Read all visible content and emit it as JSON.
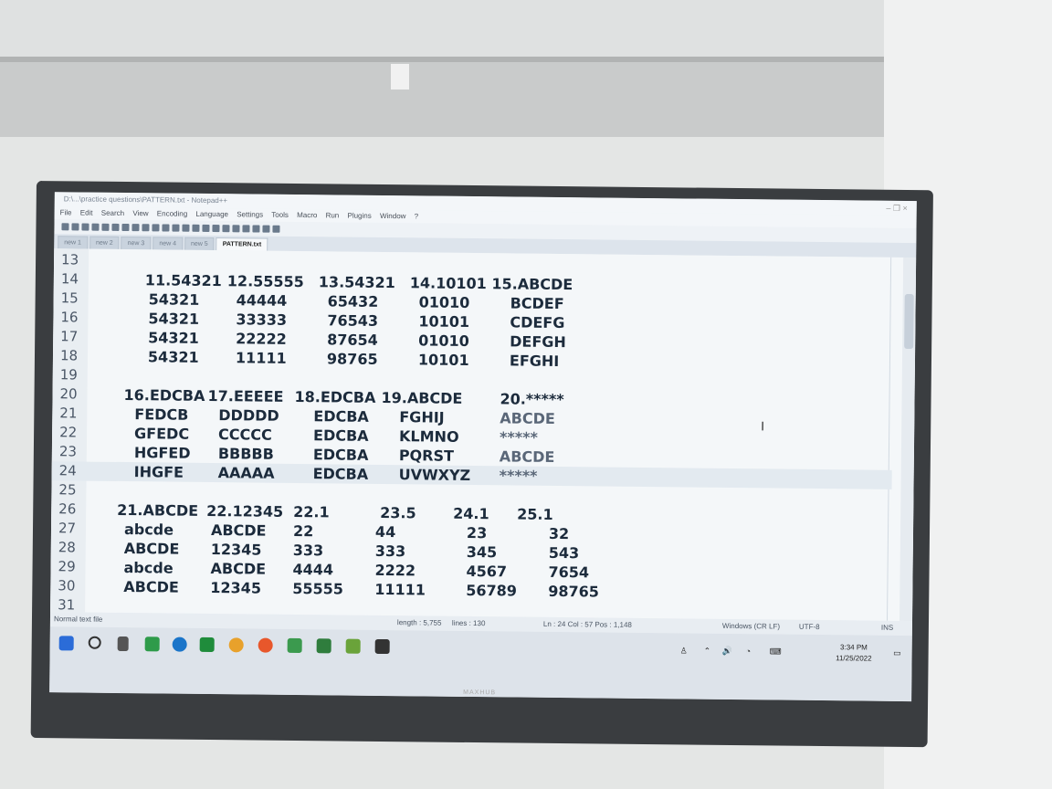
{
  "window": {
    "title": "D:\\...\\practice questions\\PATTERN.txt - Notepad++",
    "controls": "–  ❐  ×"
  },
  "menu": [
    "File",
    "Edit",
    "Search",
    "View",
    "Encoding",
    "Language",
    "Settings",
    "Tools",
    "Macro",
    "Run",
    "Plugins",
    "Window",
    "?"
  ],
  "tabs": [
    {
      "label": "new 1",
      "active": false
    },
    {
      "label": "new 2",
      "active": false
    },
    {
      "label": "new 3",
      "active": false
    },
    {
      "label": "new 4",
      "active": false
    },
    {
      "label": "new 5",
      "active": false
    },
    {
      "label": "PATTERN.txt",
      "active": true
    }
  ],
  "editor": {
    "lines": [
      {
        "n": "13",
        "segs": []
      },
      {
        "n": "14",
        "segs": [
          "11.54321",
          "12.55555",
          "13.54321",
          "14.10101 15.ABCDE"
        ]
      },
      {
        "n": "15",
        "segs": [
          "54321",
          "44444",
          "65432",
          "01010",
          "BCDEF"
        ]
      },
      {
        "n": "16",
        "segs": [
          "54321",
          "33333",
          "76543",
          "10101",
          "CDEFG"
        ]
      },
      {
        "n": "17",
        "segs": [
          "54321",
          "22222",
          "87654",
          "01010",
          "DEFGH"
        ]
      },
      {
        "n": "18",
        "segs": [
          "54321",
          "11111",
          "98765",
          "10101",
          "EFGHI"
        ]
      },
      {
        "n": "19",
        "segs": []
      },
      {
        "n": "20",
        "segs": [
          "16.EDCBA",
          "17.EEEEE",
          "18.EDCBA",
          "19.ABCDE",
          "20.*****"
        ]
      },
      {
        "n": "21",
        "segs": [
          "FEDCB",
          "DDDDD",
          "EDCBA",
          "FGHIJ",
          "ABCDE"
        ]
      },
      {
        "n": "22",
        "segs": [
          "GFEDC",
          "CCCCC",
          "EDCBA",
          "KLMNO",
          "*****"
        ]
      },
      {
        "n": "23",
        "segs": [
          "HGFED",
          "BBBBB",
          "EDCBA",
          "PQRST",
          "ABCDE"
        ]
      },
      {
        "n": "24",
        "segs": [
          "IHGFE",
          "AAAAA",
          "EDCBA",
          "UVWXYZ",
          "*****"
        ]
      },
      {
        "n": "25",
        "segs": []
      },
      {
        "n": "26",
        "segs": [
          "21.ABCDE",
          "22.12345",
          "22.1",
          "23.5",
          "24.1",
          "25.1"
        ]
      },
      {
        "n": "27",
        "segs": [
          "abcde",
          "ABCDE",
          "22",
          "44",
          "23",
          "32"
        ]
      },
      {
        "n": "28",
        "segs": [
          "ABCDE",
          "12345",
          "333",
          "333",
          "345",
          "543"
        ]
      },
      {
        "n": "29",
        "segs": [
          "abcde",
          "ABCDE",
          "4444",
          "2222",
          "4567",
          "7654"
        ]
      },
      {
        "n": "30",
        "segs": [
          "ABCDE",
          "12345",
          "55555",
          "11111",
          "56789",
          "98765"
        ]
      },
      {
        "n": "31",
        "segs": []
      }
    ],
    "current_line": "24"
  },
  "status": {
    "filetype": "Normal text file",
    "length": "length : 5,755",
    "lines": "lines : 130",
    "position": "Ln : 24   Col : 57   Pos : 1,148",
    "eol": "Windows (CR LF)",
    "encoding": "UTF-8",
    "mode": "INS"
  },
  "taskbar": {
    "time": "3:34 PM",
    "date": "11/25/2022"
  },
  "monitor": {
    "brand": "MAXHUB"
  }
}
